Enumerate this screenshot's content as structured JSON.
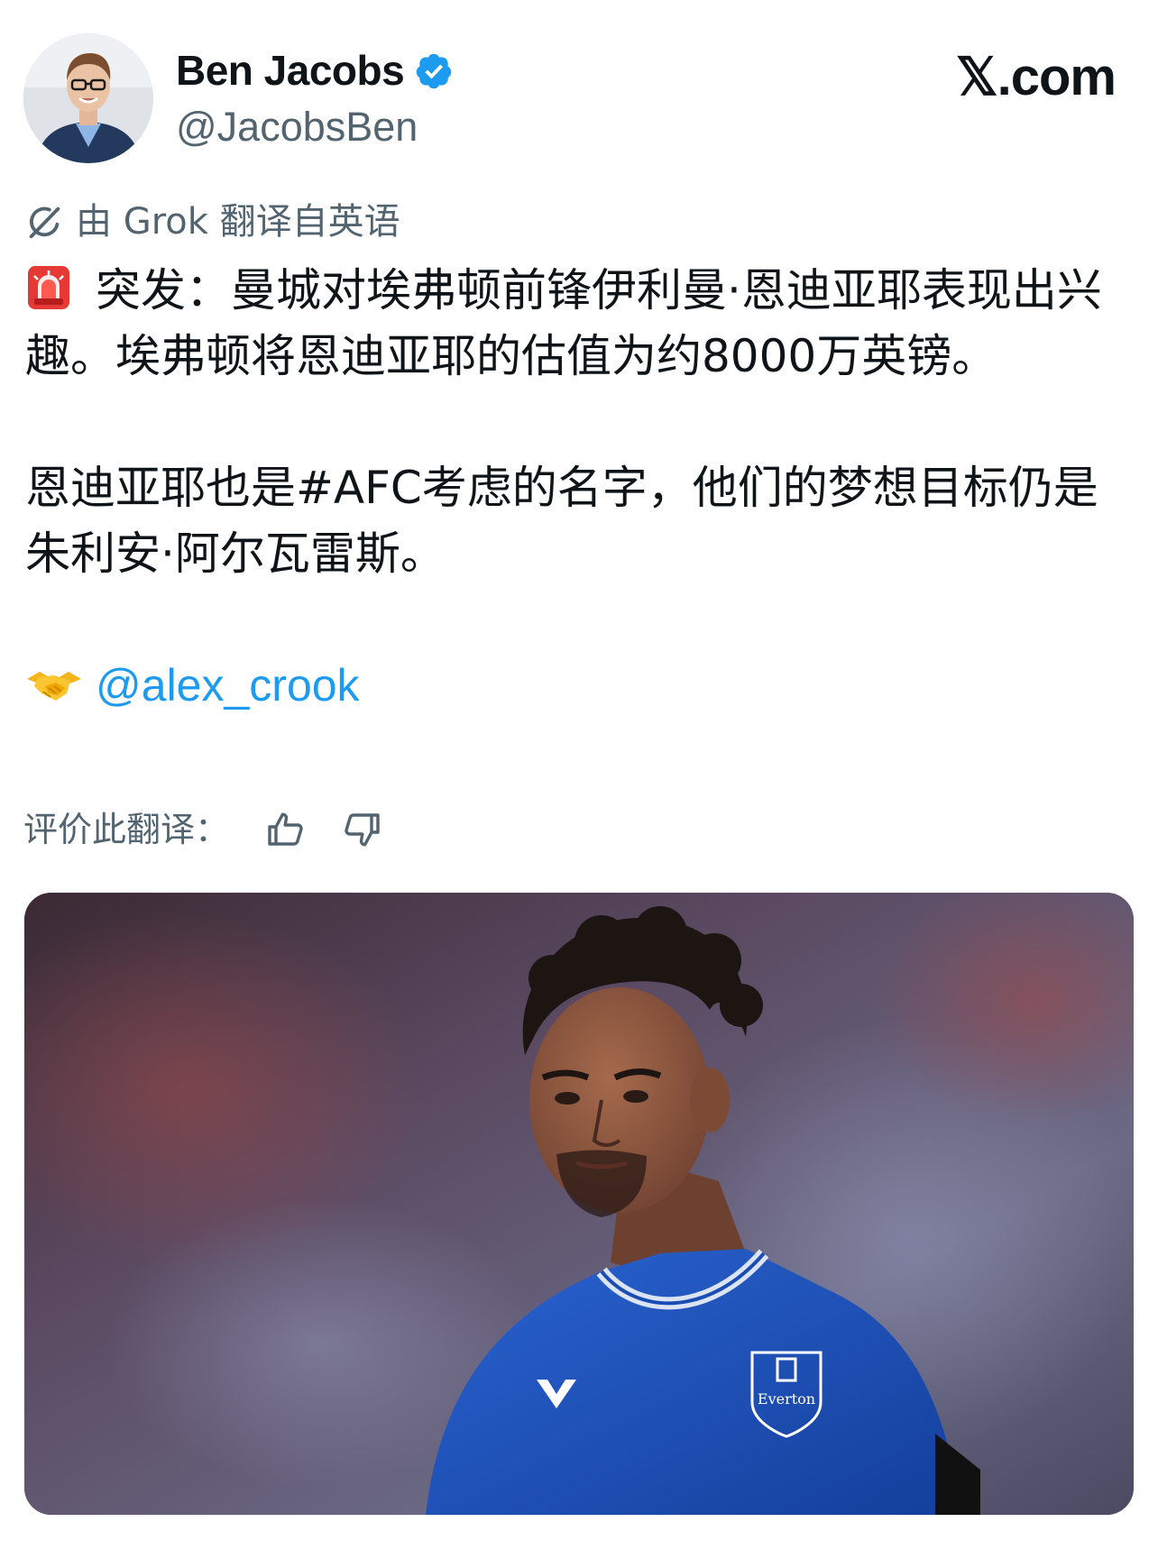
{
  "author": {
    "display_name": "Ben Jacobs",
    "handle": "@JacobsBen",
    "verified": true,
    "avatar_icon": "person-avatar"
  },
  "brand": {
    "label": "𝕏.com"
  },
  "translation": {
    "note": "由 Grok 翻译自英语",
    "icon": "grok-icon",
    "rate_label": "评价此翻译：",
    "thumbs_up_icon": "thumbs-up-icon",
    "thumbs_down_icon": "thumbs-down-icon"
  },
  "tweet": {
    "paragraph_1": "突发：曼城对埃弗顿前锋伊利曼·恩迪亚耶表现出兴趣。埃弗顿将恩迪亚耶的估值为约8000万英镑。",
    "paragraph_1_icon": "siren-icon",
    "paragraph_2": "恩迪亚耶也是#AFC考虑的名字，他们的梦想目标仍是朱利安·阿尔瓦雷斯。",
    "mention_icon": "handshake-icon",
    "mention": "@alex_crook"
  },
  "media": {
    "type": "photo",
    "crest_text": "Everton"
  },
  "colors": {
    "text": "#0f1419",
    "secondary": "#536471",
    "link": "#1d9bf0",
    "verified": "#1d9bf0",
    "jersey": "#1b4fb5"
  }
}
